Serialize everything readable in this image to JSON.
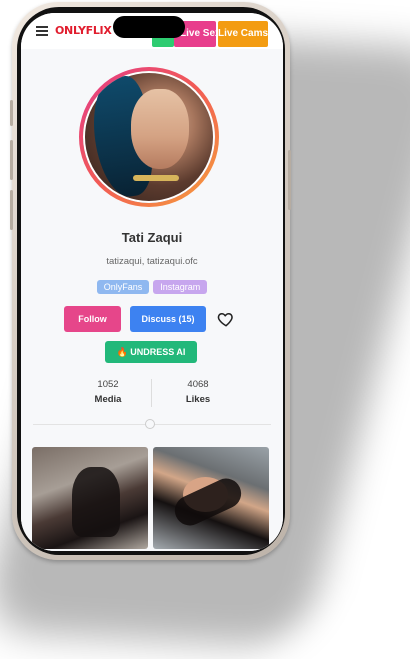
{
  "header": {
    "logo": "ONLYFLIX",
    "nav_green_label": "",
    "nav_live_sex_label": "Live Sex",
    "nav_live_cams_label": "Live Cams"
  },
  "profile": {
    "name": "Tati Zaqui",
    "handles": "tatizaqui, tatizaqui.ofc",
    "tags": [
      "OnlyFans",
      "Instagram"
    ],
    "follow_label": "Follow",
    "discuss_label": "Discuss (15)",
    "undress_label": "🔥 UNDRESS AI",
    "stats": {
      "media_count": "1052",
      "media_label": "Media",
      "likes_count": "4068",
      "likes_label": "Likes"
    }
  },
  "icons": {
    "menu": "hamburger-icon",
    "heart": "heart-icon",
    "fire": "fire-icon"
  },
  "colors": {
    "logo_red": "#e11d2e",
    "follow_pink": "#e6468a",
    "discuss_blue": "#3d82f1",
    "undress_green": "#22b87a",
    "live_sex_pink": "#e83e8c",
    "live_cams_orange": "#f39c12"
  }
}
